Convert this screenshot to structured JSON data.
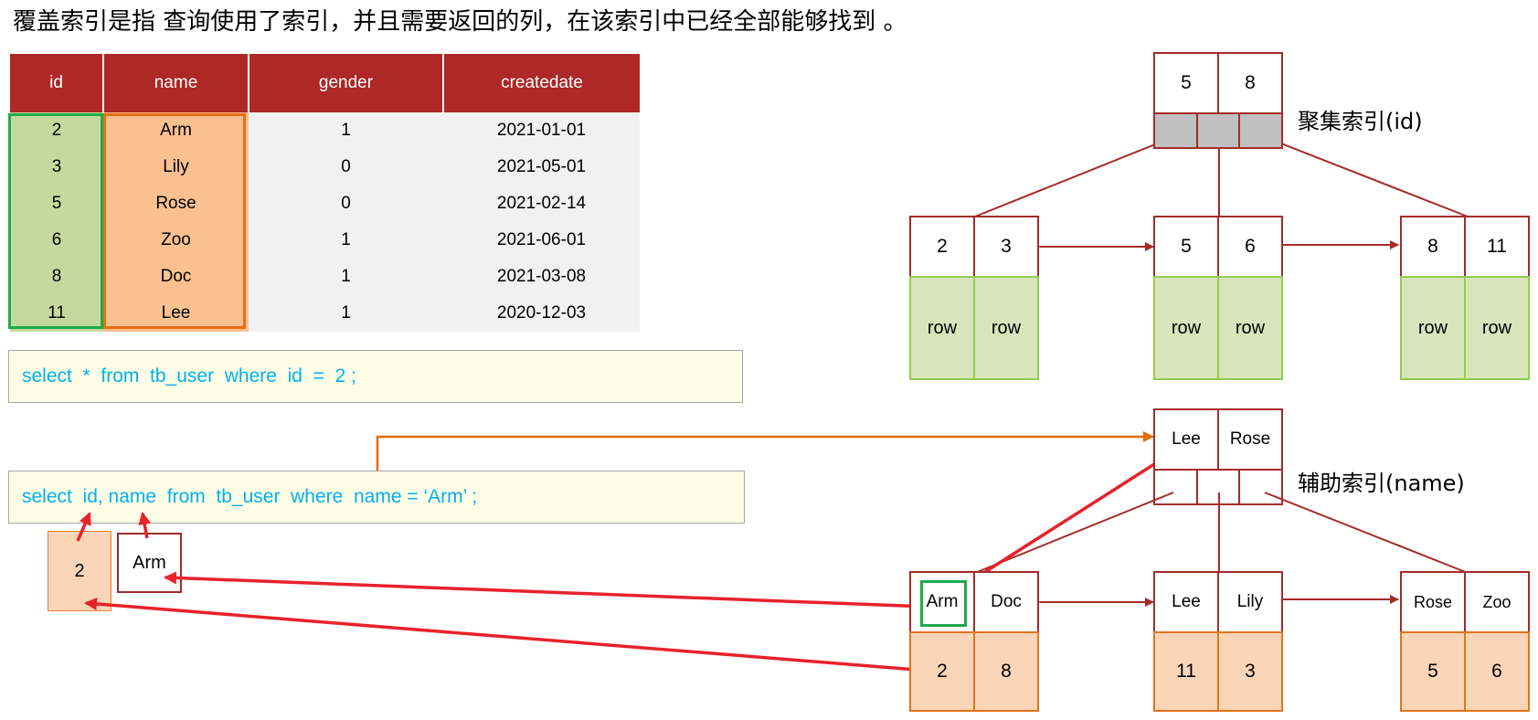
{
  "headline": "覆盖索引是指 查询使用了索引，并且需要返回的列，在该索引中已经全部能够找到 。",
  "table": {
    "columns": [
      "id",
      "name",
      "gender",
      "createdate"
    ],
    "rows": [
      [
        "2",
        "Arm",
        "1",
        "2021-01-01"
      ],
      [
        "3",
        "Lily",
        "0",
        "2021-05-01"
      ],
      [
        "5",
        "Rose",
        "0",
        "2021-02-14"
      ],
      [
        "6",
        "Zoo",
        "1",
        "2021-06-01"
      ],
      [
        "8",
        "Doc",
        "1",
        "2021-03-08"
      ],
      [
        "11",
        "Lee",
        "1",
        "2020-12-03"
      ]
    ]
  },
  "queries": {
    "q1": "select  *  from  tb_user  where  id  =  2 ;",
    "q2": "select  id, name  from  tb_user  where  name = ‘Arm’ ;"
  },
  "result": {
    "id": "2",
    "name": "Arm"
  },
  "clustered_index": {
    "label": "聚集索引(id)",
    "root": [
      "5",
      "8"
    ],
    "leaves": [
      {
        "keys": [
          "2",
          "3"
        ],
        "data": [
          "row",
          "row"
        ]
      },
      {
        "keys": [
          "5",
          "6"
        ],
        "data": [
          "row",
          "row"
        ]
      },
      {
        "keys": [
          "8",
          "11"
        ],
        "data": [
          "row",
          "row"
        ]
      }
    ]
  },
  "secondary_index": {
    "label": "辅助索引(name)",
    "root": [
      "Lee",
      "Rose"
    ],
    "leaves": [
      {
        "keys": [
          "Arm",
          "Doc"
        ],
        "data": [
          "2",
          "8"
        ]
      },
      {
        "keys": [
          "Lee",
          "Lily"
        ],
        "data": [
          "11",
          "3"
        ]
      },
      {
        "keys": [
          "Rose",
          "Zoo"
        ],
        "data": [
          "5",
          "6"
        ]
      }
    ]
  },
  "colors": {
    "header_red": "#ad2826",
    "id_column_green": "#c5d99e",
    "name_column_orange": "#fac090",
    "sql_text_blue": "#00b0f0",
    "arrow_red": "#e8222a",
    "arrow_orange": "#e46c0a"
  }
}
